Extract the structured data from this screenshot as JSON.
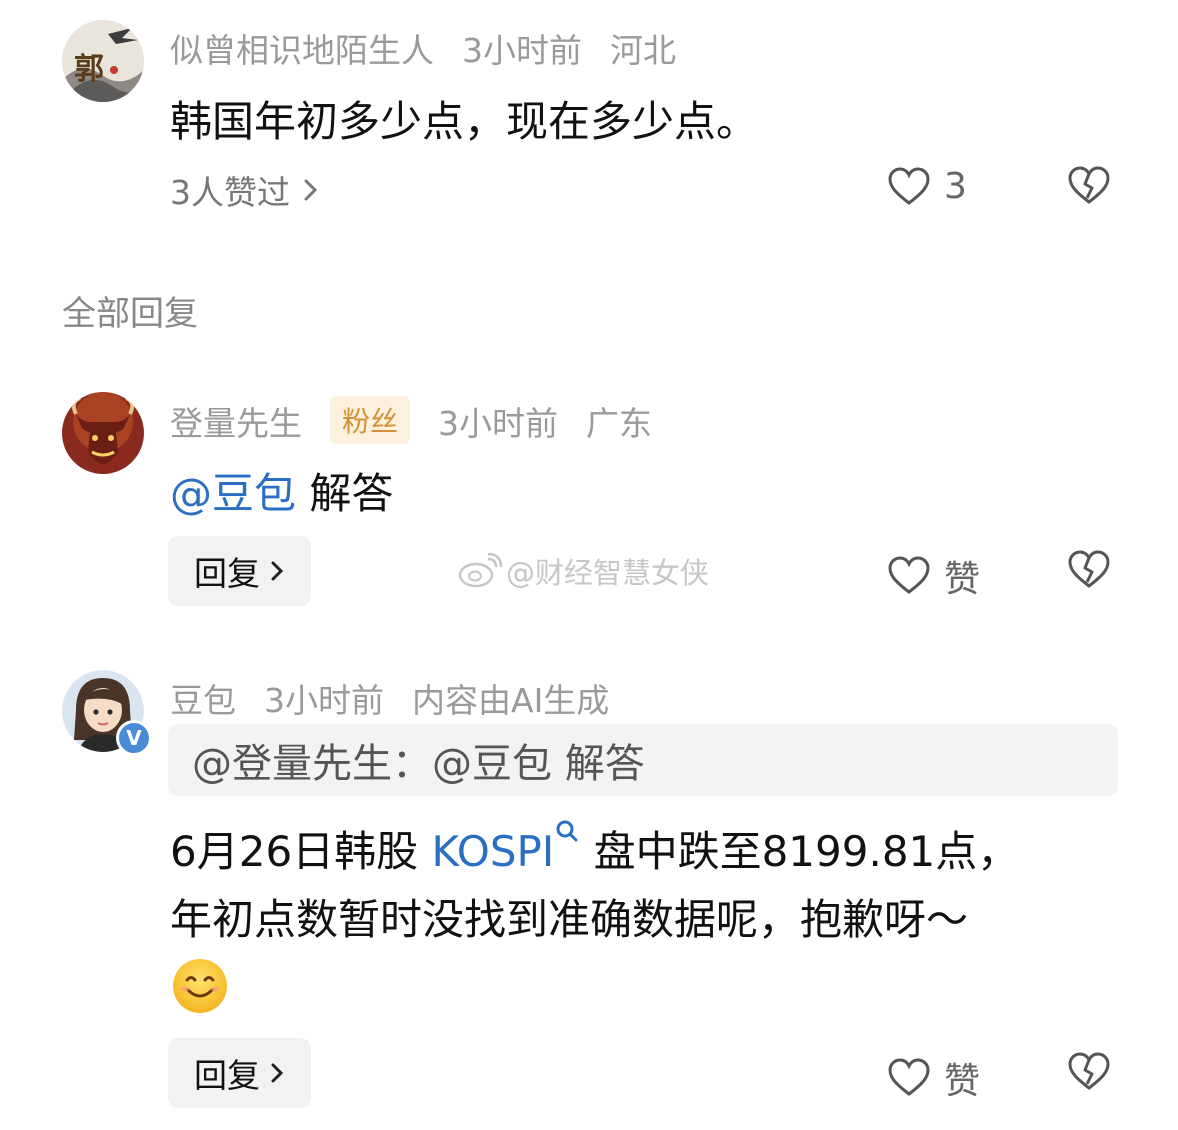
{
  "root_comment": {
    "username": "似曾相识地陌生人",
    "time": "3小时前",
    "location": "河北",
    "text": "韩国年初多少点，现在多少点。",
    "likers": "3人赞过",
    "like_count": "3",
    "avatar_char": "郭"
  },
  "section_title": "全部回复",
  "replies": [
    {
      "username": "登量先生",
      "badge": "粉丝",
      "time": "3小时前",
      "location": "广东",
      "mention": "@豆包",
      "text": "解答",
      "reply_label": "回复",
      "like_label": "赞"
    },
    {
      "username": "豆包",
      "time": "3小时前",
      "ai_note": "内容由AI生成",
      "quote": "@登量先生：@豆包 解答",
      "line1_a": "6月26日韩股",
      "line1_link": "KOSPI",
      "line1_b": "盘中跌至8199.81点，",
      "line2": "年初点数暂时没找到准确数据呢，抱歉呀～",
      "reply_label": "回复",
      "like_label": "赞",
      "verified_mark": "V"
    }
  ],
  "watermark": "@财经智慧女侠",
  "icons": {
    "like": "heart-outline-icon",
    "dislike": "broken-heart-icon",
    "chevron": "chevron-right-icon",
    "search": "search-icon",
    "weibo": "weibo-logo-icon"
  },
  "colors": {
    "mention": "#2a6fc1",
    "meta": "#9a9a9a",
    "badge_bg": "#fdf0dc",
    "badge_text": "#d4913a"
  }
}
